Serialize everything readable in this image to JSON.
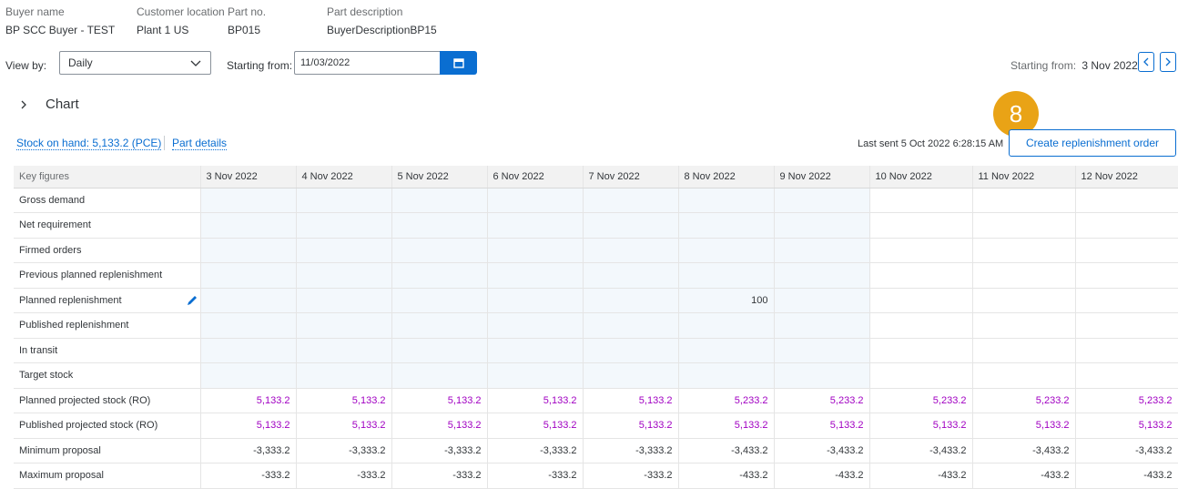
{
  "header": {
    "buyer_name_label": "Buyer name",
    "buyer_name": "BP SCC Buyer - TEST",
    "customer_location_label": "Customer location",
    "customer_location": "Plant 1 US",
    "part_no_label": "Part no.",
    "part_no": "BP015",
    "part_description_label": "Part description",
    "part_description": "BuyerDescriptionBP15"
  },
  "controls": {
    "view_by_label": "View by:",
    "view_by_value": "Daily",
    "starting_from_label": "Starting from:",
    "starting_from_value": "11/03/2022",
    "right_starting_from_label": "Starting from:",
    "right_starting_from_value": "3 Nov 2022"
  },
  "chart_section": {
    "label": "Chart"
  },
  "links": {
    "stock_on_hand": "Stock on hand: 5,133.2  (PCE)",
    "part_details": "Part details"
  },
  "last_sent": "Last sent 5 Oct 2022 6:28:15 AM",
  "create_button_label": "Create replenishment order",
  "step_badge": "8",
  "colors": {
    "accent": "#0a6ed1",
    "badge": "#e9a316",
    "projected_stock": "#a100c2",
    "shaded_cell": "#f3f8fc"
  },
  "table": {
    "key_figures_header": "Key figures",
    "dates": [
      "3 Nov 2022",
      "4 Nov 2022",
      "5 Nov 2022",
      "6 Nov 2022",
      "7 Nov 2022",
      "8 Nov 2022",
      "9 Nov 2022",
      "10 Nov 2022",
      "11 Nov 2022",
      "12 Nov 2022"
    ],
    "rows": [
      {
        "label": "Gross demand",
        "values": [
          "",
          "",
          "",
          "",
          "",
          "",
          "",
          "",
          "",
          ""
        ]
      },
      {
        "label": "Net requirement",
        "values": [
          "",
          "",
          "",
          "",
          "",
          "",
          "",
          "",
          "",
          ""
        ]
      },
      {
        "label": "Firmed orders",
        "values": [
          "",
          "",
          "",
          "",
          "",
          "",
          "",
          "",
          "",
          ""
        ]
      },
      {
        "label": "Previous planned replenishment",
        "values": [
          "",
          "",
          "",
          "",
          "",
          "",
          "",
          "",
          "",
          ""
        ]
      },
      {
        "label": "Planned replenishment",
        "editable": true,
        "values": [
          "",
          "",
          "",
          "",
          "",
          "100",
          "",
          "",
          "",
          ""
        ]
      },
      {
        "label": "Published replenishment",
        "values": [
          "",
          "",
          "",
          "",
          "",
          "",
          "",
          "",
          "",
          ""
        ]
      },
      {
        "label": "In transit",
        "values": [
          "",
          "",
          "",
          "",
          "",
          "",
          "",
          "",
          "",
          ""
        ]
      },
      {
        "label": "Target stock",
        "values": [
          "",
          "",
          "",
          "",
          "",
          "",
          "",
          "",
          "",
          ""
        ]
      },
      {
        "label": "Planned projected stock (RO)",
        "pink": true,
        "values": [
          "5,133.2",
          "5,133.2",
          "5,133.2",
          "5,133.2",
          "5,133.2",
          "5,233.2",
          "5,233.2",
          "5,233.2",
          "5,233.2",
          "5,233.2"
        ]
      },
      {
        "label": "Published projected stock (RO)",
        "pink": true,
        "values": [
          "5,133.2",
          "5,133.2",
          "5,133.2",
          "5,133.2",
          "5,133.2",
          "5,133.2",
          "5,133.2",
          "5,133.2",
          "5,133.2",
          "5,133.2"
        ]
      },
      {
        "label": "Minimum proposal",
        "values": [
          "-3,333.2",
          "-3,333.2",
          "-3,333.2",
          "-3,333.2",
          "-3,333.2",
          "-3,433.2",
          "-3,433.2",
          "-3,433.2",
          "-3,433.2",
          "-3,433.2"
        ]
      },
      {
        "label": "Maximum proposal",
        "values": [
          "-333.2",
          "-333.2",
          "-333.2",
          "-333.2",
          "-333.2",
          "-433.2",
          "-433.2",
          "-433.2",
          "-433.2",
          "-433.2"
        ]
      }
    ]
  }
}
